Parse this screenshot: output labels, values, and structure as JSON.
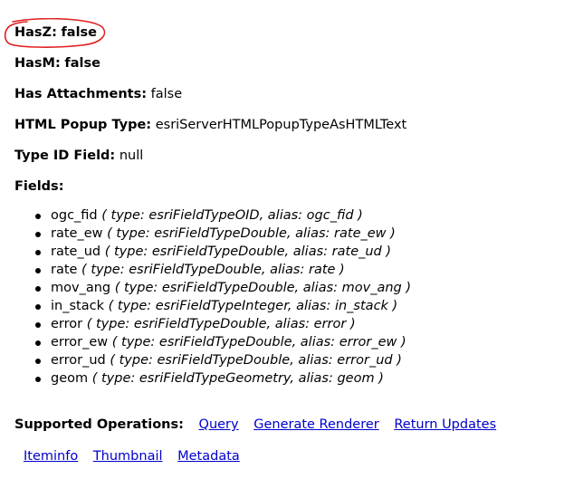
{
  "props": [
    {
      "label": "HasZ:",
      "value": "false",
      "bold_value": true
    },
    {
      "label": "HasM:",
      "value": "false",
      "bold_value": true
    },
    {
      "label": "Has Attachments:",
      "value": "false"
    },
    {
      "label": "HTML Popup Type:",
      "value": "esriServerHTMLPopupTypeAsHTMLText"
    },
    {
      "label": "Type ID Field:",
      "value": "null"
    }
  ],
  "fields_label": "Fields:",
  "fields": [
    {
      "name": "ogc_fid",
      "type": "esriFieldTypeOID",
      "alias": "ogc_fid"
    },
    {
      "name": "rate_ew",
      "type": "esriFieldTypeDouble",
      "alias": "rate_ew"
    },
    {
      "name": "rate_ud",
      "type": "esriFieldTypeDouble",
      "alias": "rate_ud"
    },
    {
      "name": "rate",
      "type": "esriFieldTypeDouble",
      "alias": "rate"
    },
    {
      "name": "mov_ang",
      "type": "esriFieldTypeDouble",
      "alias": "mov_ang"
    },
    {
      "name": "in_stack",
      "type": "esriFieldTypeInteger",
      "alias": "in_stack"
    },
    {
      "name": "error",
      "type": "esriFieldTypeDouble",
      "alias": "error"
    },
    {
      "name": "error_ew",
      "type": "esriFieldTypeDouble",
      "alias": "error_ew"
    },
    {
      "name": "error_ud",
      "type": "esriFieldTypeDouble",
      "alias": "error_ud"
    },
    {
      "name": "geom",
      "type": "esriFieldTypeGeometry",
      "alias": "geom"
    }
  ],
  "supported_operations": {
    "label": "Supported Operations:",
    "links": [
      "Query",
      "Generate Renderer",
      "Return Updates"
    ]
  },
  "bottom_links": [
    "Iteminfo",
    "Thumbnail",
    "Metadata"
  ],
  "colors": {
    "link": "#0000cc",
    "annotation": "#e02020"
  }
}
